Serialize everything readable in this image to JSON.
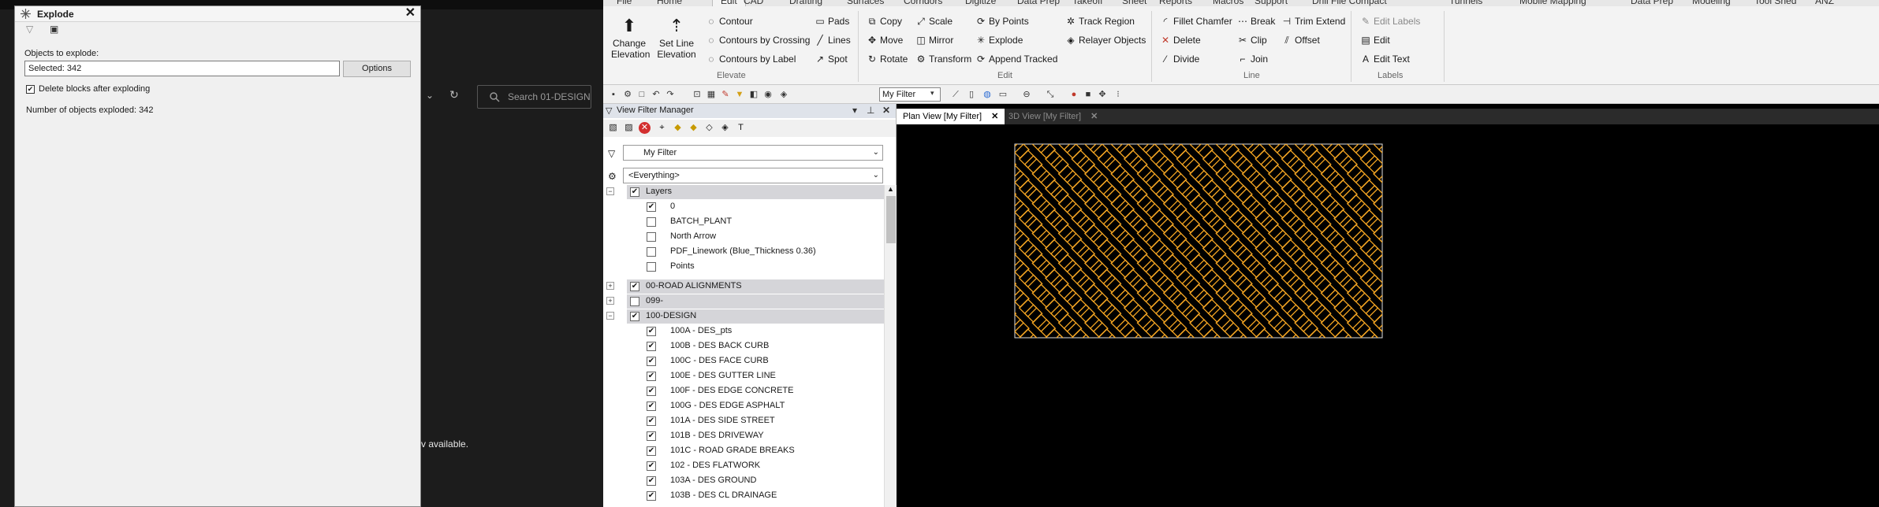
{
  "explode_dialog": {
    "title": "Explode",
    "close": "✕",
    "objects_label": "Objects to explode:",
    "selected_value": "Selected: 342",
    "options_button": "Options",
    "delete_blocks_label": "Delete blocks after exploding",
    "delete_blocks_checked": true,
    "count_label": "Number of objects exploded: 342"
  },
  "background_app": {
    "search_placeholder": "Search 01-DESIGN",
    "status_text": "v available."
  },
  "ribbon": {
    "tabs": [
      "File",
      "Home",
      "Edit",
      "CAD",
      "Drafting",
      "Surfaces",
      "Corridors",
      "Digitize",
      "Data Prep",
      "Takeoff",
      "Sheet",
      "Reports",
      "Macros",
      "Support",
      "Drill File Compact",
      "Tunnels",
      "Mobile Mapping",
      "Data Prep",
      "Modeling",
      "Tool Shed",
      "ANZ"
    ],
    "active_tab": "Edit",
    "elevate": {
      "change_elevation": "Change Elevation",
      "set_line_elevation": "Set Line Elevation",
      "contour": "Contour",
      "contours_by_crossing": "Contours by Crossing",
      "contours_by_label": "Contours by Label",
      "pads": "Pads",
      "lines": "Lines",
      "spot": "Spot",
      "group_label": "Elevate"
    },
    "edit": {
      "copy": "Copy",
      "move": "Move",
      "rotate": "Rotate",
      "scale": "Scale",
      "mirror": "Mirror",
      "transform": "Transform",
      "by_points": "By Points",
      "explode": "Explode",
      "append_tracked": "Append Tracked",
      "track_region": "Track Region",
      "relayer_objects": "Relayer Objects",
      "group_label": "Edit"
    },
    "line": {
      "fillet_chamfer": "Fillet Chamfer",
      "delete": "Delete",
      "divide": "Divide",
      "break": "Break",
      "clip": "Clip",
      "join": "Join",
      "trim_extend": "Trim Extend",
      "offset": "Offset",
      "group_label": "Line"
    },
    "labels": {
      "edit_labels": "Edit Labels",
      "edit": "Edit",
      "edit_text": "Edit Text",
      "group_label": "Labels"
    }
  },
  "toolbar": {
    "filter_value": "My Filter"
  },
  "view_filter_manager": {
    "title": "View Filter Manager",
    "pin": "⊥",
    "close": "✕",
    "filter_combo": "My Filter",
    "scope_combo": "<Everything>",
    "tree": [
      {
        "label": "Layers",
        "kind": "group",
        "checked": true,
        "expanded": true
      },
      {
        "label": "0",
        "kind": "item",
        "checked": true
      },
      {
        "label": "BATCH_PLANT",
        "kind": "item",
        "checked": false
      },
      {
        "label": "North Arrow",
        "kind": "item",
        "checked": false
      },
      {
        "label": "PDF_Linework (Blue_Thickness 0.36)",
        "kind": "item",
        "checked": false
      },
      {
        "label": "Points",
        "kind": "item",
        "checked": false
      },
      {
        "label": "00-ROAD ALIGNMENTS",
        "kind": "group",
        "checked": true,
        "expanded": false
      },
      {
        "label": "099-",
        "kind": "group",
        "checked": false,
        "expanded": false
      },
      {
        "label": "100-DESIGN",
        "kind": "group",
        "checked": true,
        "expanded": true
      },
      {
        "label": "100A - DES_pts",
        "kind": "item",
        "checked": true
      },
      {
        "label": "100B - DES BACK CURB",
        "kind": "item",
        "checked": true
      },
      {
        "label": "100C - DES FACE CURB",
        "kind": "item",
        "checked": true
      },
      {
        "label": "100E - DES GUTTER LINE",
        "kind": "item",
        "checked": true
      },
      {
        "label": "100F - DES EDGE CONCRETE",
        "kind": "item",
        "checked": true
      },
      {
        "label": "100G - DES EDGE ASPHALT",
        "kind": "item",
        "checked": true
      },
      {
        "label": "101A - DES SIDE STREET",
        "kind": "item",
        "checked": true
      },
      {
        "label": "101B - DES DRIVEWAY",
        "kind": "item",
        "checked": true
      },
      {
        "label": "101C - ROAD GRADE BREAKS",
        "kind": "item",
        "checked": true
      },
      {
        "label": "102 - DES FLATWORK",
        "kind": "item",
        "checked": true
      },
      {
        "label": "103A - DES GROUND",
        "kind": "item",
        "checked": true
      },
      {
        "label": "103B - DES CL DRAINAGE",
        "kind": "item",
        "checked": true
      }
    ]
  },
  "plan_view": {
    "tabs": [
      {
        "label": "Plan View [My Filter]",
        "active": true
      },
      {
        "label": "3D View [My Filter]",
        "active": false
      }
    ],
    "tab_close": "✕",
    "pattern_color": "#f5a623",
    "pattern_rows": 13,
    "pattern_cols": 14
  }
}
